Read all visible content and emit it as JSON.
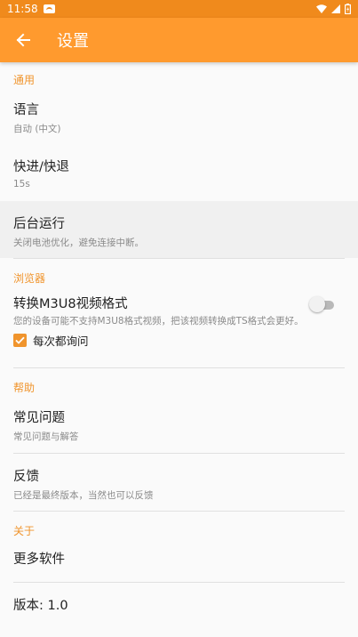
{
  "status_bar": {
    "time": "11:58",
    "icons": [
      "app-notification-icon",
      "wifi-icon",
      "signal-icon",
      "battery-icon"
    ]
  },
  "toolbar": {
    "title": "设置",
    "back_icon": "arrow-left-icon"
  },
  "colors": {
    "toolbar": "#ff9a2e",
    "status_bar": "#f08a1c",
    "accent": "#f0942c"
  },
  "sections": {
    "general": {
      "header": "通用",
      "language": {
        "title": "语言",
        "summary": "自动 (中文)"
      },
      "seek": {
        "title": "快进/快退",
        "summary": "15s"
      },
      "background": {
        "title": "后台运行",
        "summary": "关闭电池优化，避免连接中断。"
      }
    },
    "browser": {
      "header": "浏览器",
      "convert_m3u8": {
        "title": "转换M3U8视频格式",
        "summary": "您的设备可能不支持M3U8格式视频，把该视频转换成TS格式会更好。",
        "enabled": false
      },
      "ask_every_time": {
        "label": "每次都询问",
        "checked": true
      }
    },
    "help": {
      "header": "帮助",
      "faq": {
        "title": "常见问题",
        "summary": "常见问题与解答"
      },
      "feedback": {
        "title": "反馈",
        "summary": "已经是最终版本，当然也可以反馈"
      }
    },
    "about": {
      "header": "关于",
      "more_apps": {
        "title": "更多软件"
      },
      "version": {
        "title": "版本: 1.0"
      }
    }
  }
}
